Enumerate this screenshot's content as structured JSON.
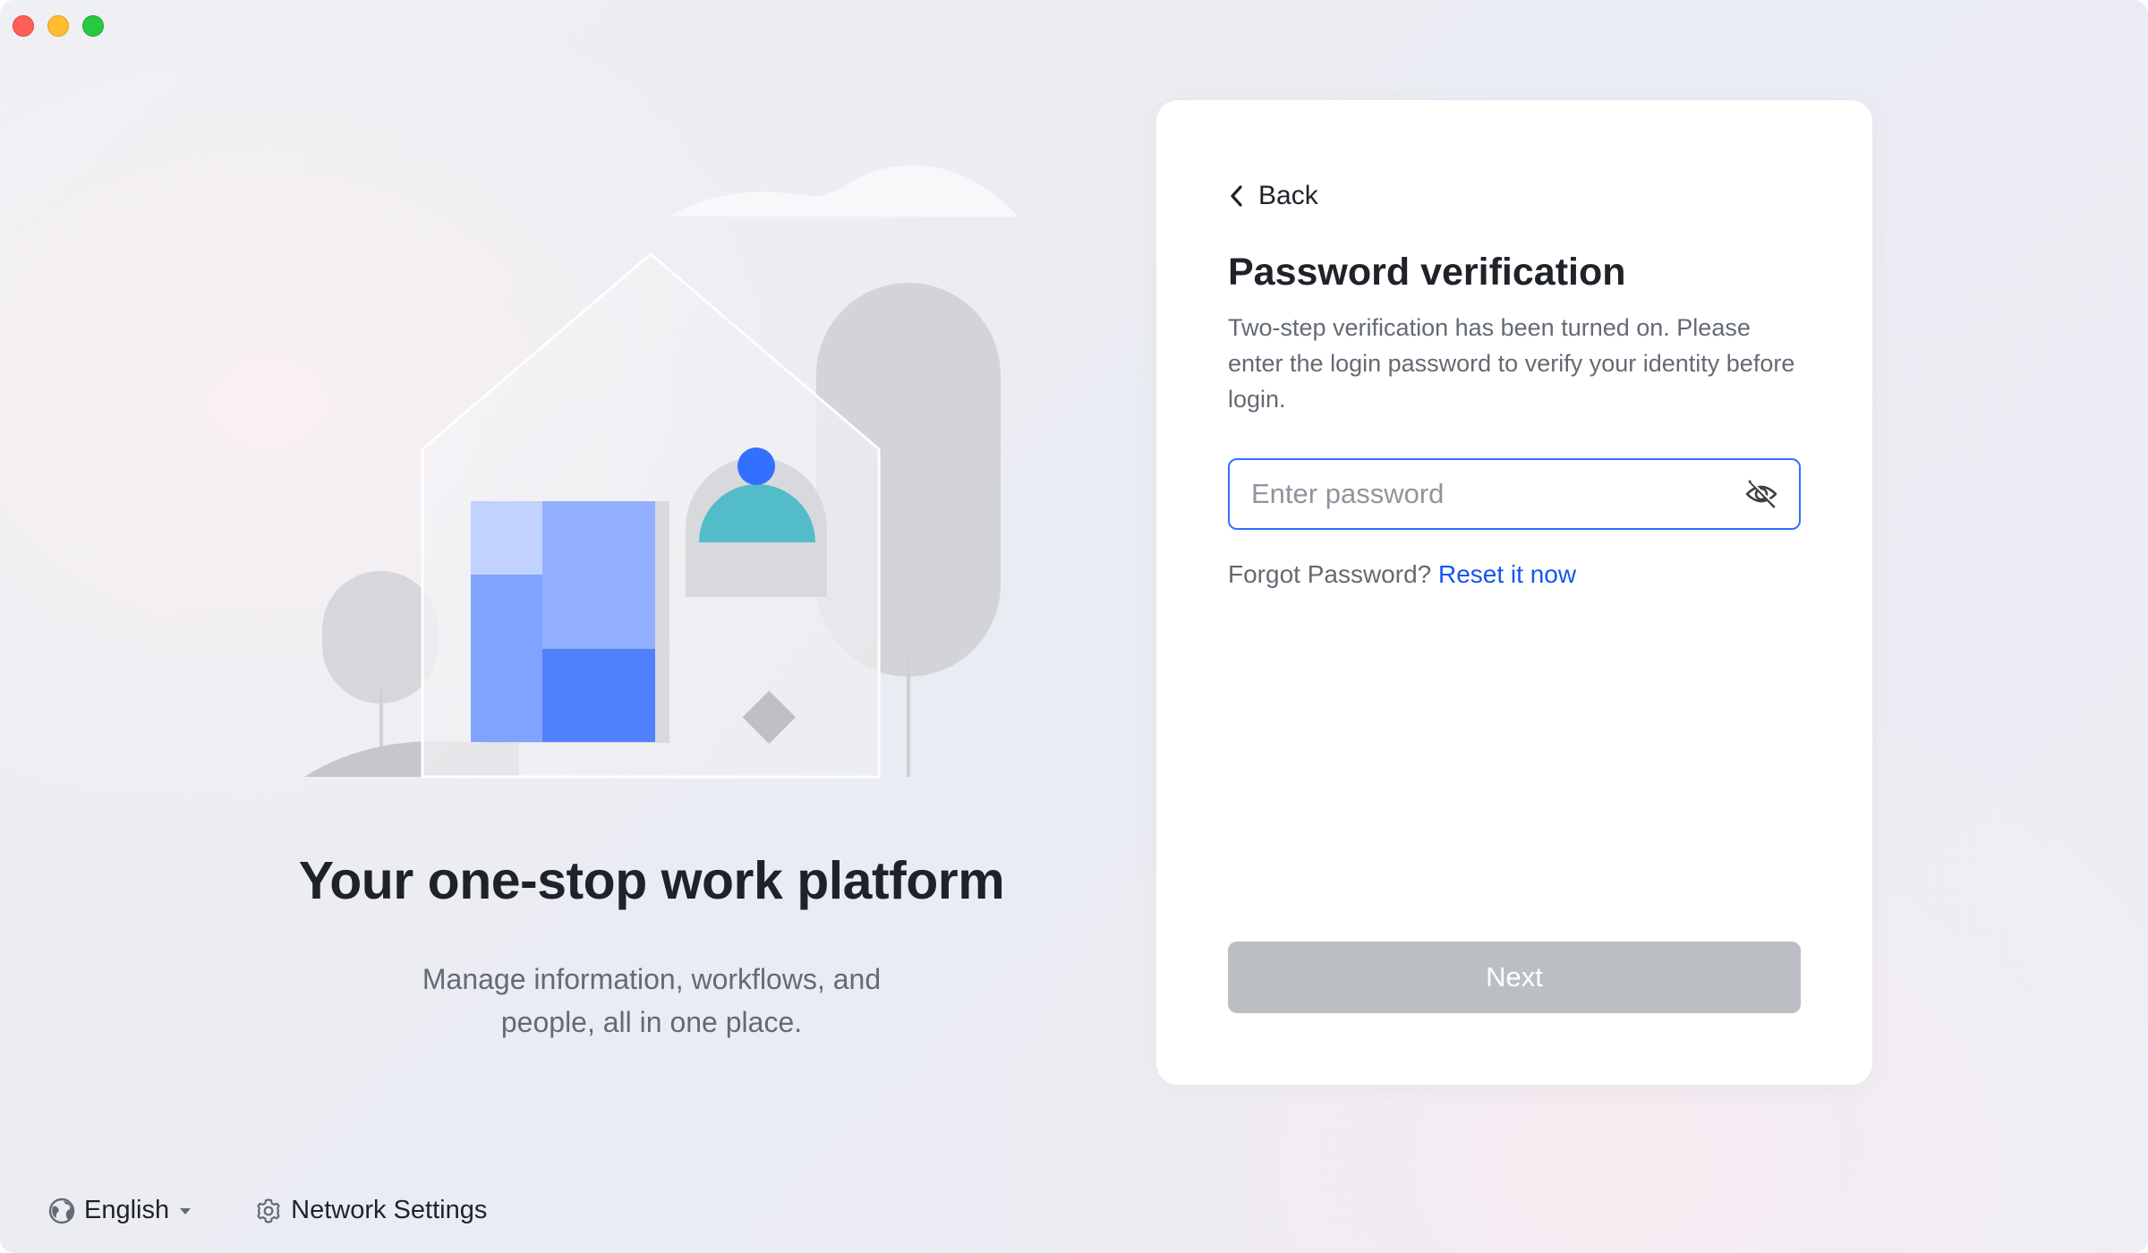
{
  "window": {
    "controls": [
      "close",
      "minimize",
      "zoom"
    ]
  },
  "hero": {
    "title": "Your one-stop work platform",
    "subtitle_line1": "Manage information, workflows, and",
    "subtitle_line2": "people, all in one place."
  },
  "footer": {
    "language_label": "English",
    "language_icon": "globe-icon",
    "network_label": "Network Settings",
    "network_icon": "gear-icon"
  },
  "card": {
    "back_label": "Back",
    "title": "Password verification",
    "description": "Two-step verification has been turned on. Please enter the login password to verify your identity before login.",
    "password_placeholder": "Enter password",
    "password_value": "",
    "forgot_text": "Forgot Password?",
    "reset_link": "Reset it now",
    "next_label": "Next",
    "next_enabled": false
  },
  "colors": {
    "accent": "#3370ff",
    "link": "#1456f0",
    "disabled_button": "#bbbfc4",
    "title_text": "#1f2329",
    "secondary_text": "#646a73"
  }
}
